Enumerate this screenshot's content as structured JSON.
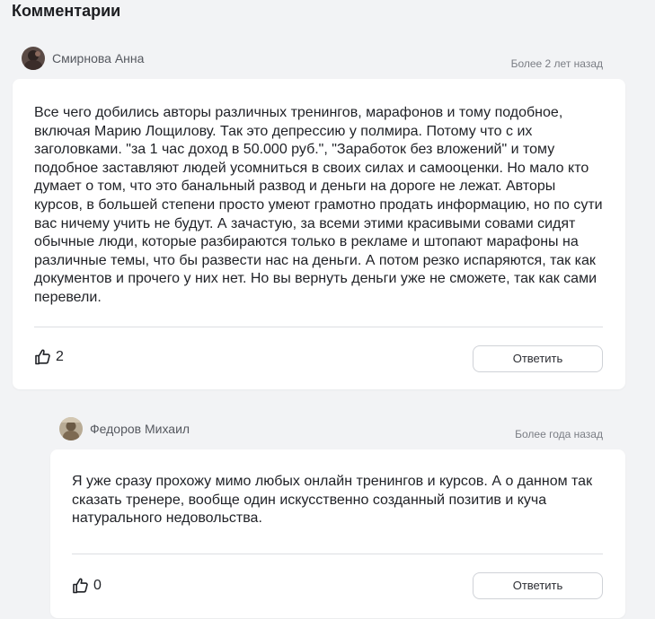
{
  "section": {
    "title": "Комментарии"
  },
  "comments": [
    {
      "author": "Смирнова Анна",
      "time": "Более 2 лет назад",
      "text": "Все чего добились авторы различных тренингов, марафонов и тому подобное, включая Марию Лощилову. Так это депрессию у полмира. Потому что с их заголовками. \"за 1 час доход в 50.000 руб.\", \"Заработок без вложений\" и тому подобное заставляют людей усомниться в своих силах и самооценки. Но мало кто думает о том, что это банальный развод и деньги на дороге не лежат. Авторы курсов, в большей степени просто умеют грамотно продать информацию, но по сути вас ничему учить не будут. А зачастую, за всеми этими красивыми совами сидят обычные люди, которые разбираются только в рекламе и штопают марафоны на различные темы, что бы развести нас на деньги. А потом резко испаряются, так как документов и прочего у них нет. Но вы вернуть деньги уже не сможете, так как сами перевели.",
      "likes": "2",
      "reply_label": "Ответить"
    },
    {
      "author": "Федоров Михаил",
      "time": "Более года назад",
      "text": "Я уже сразу прохожу мимо любых онлайн тренингов и курсов. А о данном так сказать тренере, вообще один искусственно созданный позитив и куча натурального недовольства.",
      "likes": "0",
      "reply_label": "Ответить"
    }
  ],
  "icons": {
    "like": "thumbs-up-icon"
  }
}
